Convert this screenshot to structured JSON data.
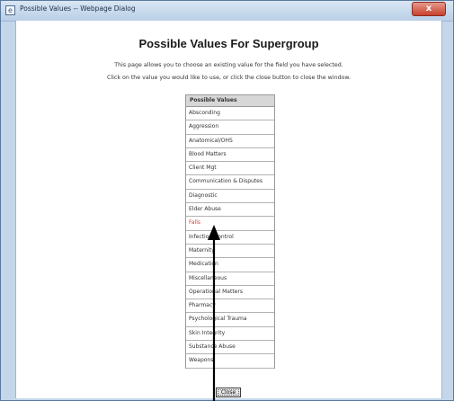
{
  "window": {
    "title": "Possible Values -- Webpage Dialog",
    "close_glyph": "x"
  },
  "page": {
    "heading": "Possible Values For Supergroup",
    "intro_line1": "This page allows you to choose an existing value for the field you have selected.",
    "intro_line2": "Click on the value you would like to use, or click the close button to close the window."
  },
  "table": {
    "header": "Possible Values",
    "rows": [
      "Absconding",
      "Aggression",
      "Anatomical/OHS",
      "Blood Matters",
      "Client Mgt",
      "Communication & Disputes",
      "Diagnostic",
      "Elder Abuse",
      "Falls",
      "Infection Control",
      "Maternity",
      "Medication",
      "Miscellaneous",
      "Operational Matters",
      "Pharmacy",
      "Psychological Trauma",
      "Skin Integrity",
      "Substance Abuse",
      "Weapons"
    ],
    "highlight_color": "#d8413a"
  },
  "buttons": {
    "close_label": "Close"
  },
  "icons": {
    "window_icon": "webpage-dialog-icon",
    "annotation": "arrow-up-icon"
  }
}
